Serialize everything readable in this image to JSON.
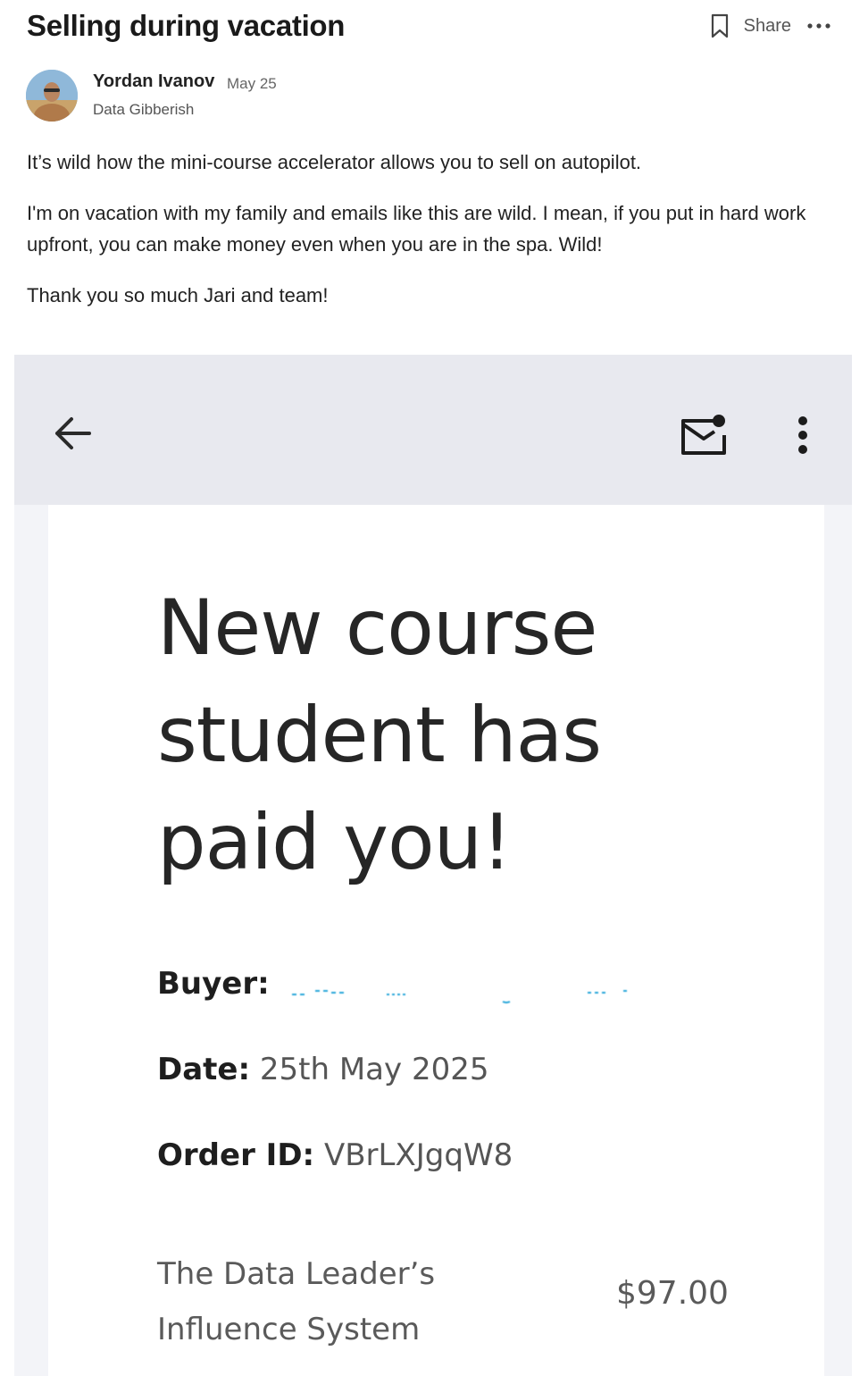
{
  "post": {
    "title": "Selling during vacation",
    "share_label": "Share",
    "author": "Yordan Ivanov",
    "date": "May 25",
    "publication": "Data Gibberish",
    "paragraphs": [
      "It’s wild how the mini-course accelerator allows you to sell on autopilot.",
      "I'm on vacation with my family and emails like this are wild. I mean, if you put in hard work upfront, you can make money even when you are in the spa. Wild!",
      "Thank you so much Jari and team!"
    ]
  },
  "email": {
    "headline": "New course student has paid you!",
    "buyer_label": "Buyer:",
    "date_label": "Date:",
    "date_value": "25th May 2025",
    "order_label": "Order ID:",
    "order_value": "VBrLXJgqW8",
    "product_name": "The Data Leader’s Influence System",
    "price": "$97.00"
  },
  "icons": [
    "bookmark-icon",
    "more-icon",
    "back-arrow-icon",
    "mail-unread-icon",
    "kebab-menu-icon"
  ],
  "colors": {
    "title": "#1a1a1a",
    "email_bg": "#e8e9ef",
    "headline": "#262626",
    "blur_accent": "#2aa7d9"
  }
}
